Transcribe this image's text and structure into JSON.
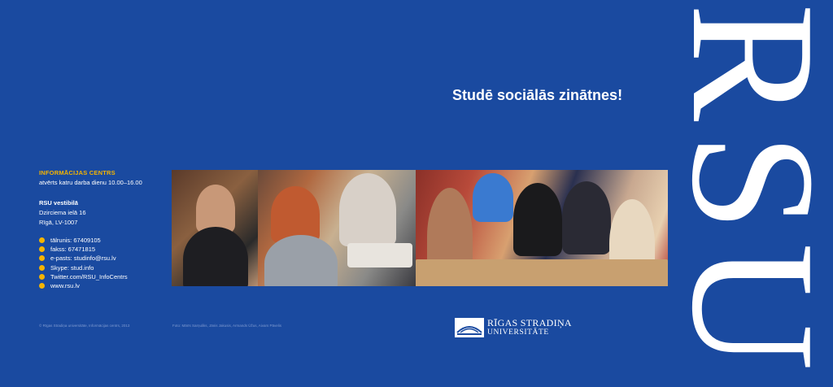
{
  "headline": "Studē sociālās zinātnes!",
  "vertical_wordmark": "RSU",
  "info_centre": {
    "title": "INFORMĀCIJAS CENTRS",
    "hours": "atvērts katru darba dienu 10.00–16.00"
  },
  "lobby": {
    "title": "RSU vestibilā",
    "address_line1": "Dzirciema ielā 16",
    "address_line2": "Rīgā, LV-1007"
  },
  "contacts": [
    "tālrunis: 67409105",
    "fakss: 67471815",
    "e-pasts: studinfo@rsu.lv",
    "Skype: stud.info",
    "Twitter.com/RSU_InfoCentrs",
    "www.rsu.lv"
  ],
  "footnotes": {
    "left": "© Rīgas Stradiņa universitāte, Informācijas centrs, 2013",
    "right": "Foto: Mārīs Sarņuliks, Jānis Jakusis, Armands Ūžus, Aivars Pāvelis"
  },
  "logo": {
    "line1": "RĪGAS STRADIŅA",
    "line2": "UNIVERSITĀTE"
  },
  "colors": {
    "background": "#1a4aa0",
    "accent": "#f5b400",
    "text": "#ffffff"
  },
  "photos": [
    {
      "name": "student-portrait-photo"
    },
    {
      "name": "students-laptop-photo"
    },
    {
      "name": "lecture-hall-students-photo"
    }
  ]
}
